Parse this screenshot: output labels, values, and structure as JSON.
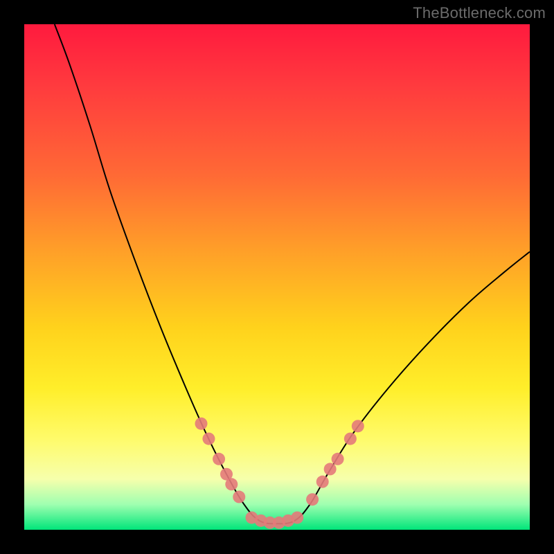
{
  "watermark": "TheBottleneck.com",
  "chart_data": {
    "type": "line",
    "title": "",
    "xlabel": "",
    "ylabel": "",
    "xlim": [
      0,
      100
    ],
    "ylim": [
      0,
      100
    ],
    "grid": false,
    "legend": false,
    "note": "Bottleneck-style V-curve on a heat gradient background. No numeric tick labels are visible; x/y percentages estimated from plot area.",
    "series": [
      {
        "name": "curve",
        "color": "#000000",
        "stroke_width": 2,
        "points": [
          {
            "x": 6.0,
            "y": 100.0
          },
          {
            "x": 9.0,
            "y": 92.0
          },
          {
            "x": 13.0,
            "y": 80.0
          },
          {
            "x": 17.0,
            "y": 67.0
          },
          {
            "x": 22.0,
            "y": 53.0
          },
          {
            "x": 27.0,
            "y": 40.0
          },
          {
            "x": 32.0,
            "y": 28.0
          },
          {
            "x": 36.0,
            "y": 19.0
          },
          {
            "x": 40.0,
            "y": 11.0
          },
          {
            "x": 43.5,
            "y": 5.0
          },
          {
            "x": 46.5,
            "y": 1.8
          },
          {
            "x": 50.0,
            "y": 1.2
          },
          {
            "x": 53.5,
            "y": 1.8
          },
          {
            "x": 56.5,
            "y": 5.0
          },
          {
            "x": 60.0,
            "y": 11.0
          },
          {
            "x": 65.0,
            "y": 19.0
          },
          {
            "x": 72.0,
            "y": 28.0
          },
          {
            "x": 80.0,
            "y": 37.0
          },
          {
            "x": 88.0,
            "y": 45.0
          },
          {
            "x": 95.0,
            "y": 51.0
          },
          {
            "x": 100.0,
            "y": 55.0
          }
        ]
      }
    ],
    "markers": {
      "name": "highlighted-points",
      "color": "#e47a7a",
      "radius": 9,
      "points": [
        {
          "x": 35.0,
          "y": 21.0
        },
        {
          "x": 36.5,
          "y": 18.0
        },
        {
          "x": 38.5,
          "y": 14.0
        },
        {
          "x": 40.0,
          "y": 11.0
        },
        {
          "x": 41.0,
          "y": 9.0
        },
        {
          "x": 42.5,
          "y": 6.5
        },
        {
          "x": 45.0,
          "y": 2.4
        },
        {
          "x": 46.8,
          "y": 1.8
        },
        {
          "x": 48.6,
          "y": 1.4
        },
        {
          "x": 50.4,
          "y": 1.4
        },
        {
          "x": 52.2,
          "y": 1.8
        },
        {
          "x": 54.0,
          "y": 2.4
        },
        {
          "x": 57.0,
          "y": 6.0
        },
        {
          "x": 59.0,
          "y": 9.5
        },
        {
          "x": 60.5,
          "y": 12.0
        },
        {
          "x": 62.0,
          "y": 14.0
        },
        {
          "x": 64.5,
          "y": 18.0
        },
        {
          "x": 66.0,
          "y": 20.5
        }
      ]
    }
  }
}
